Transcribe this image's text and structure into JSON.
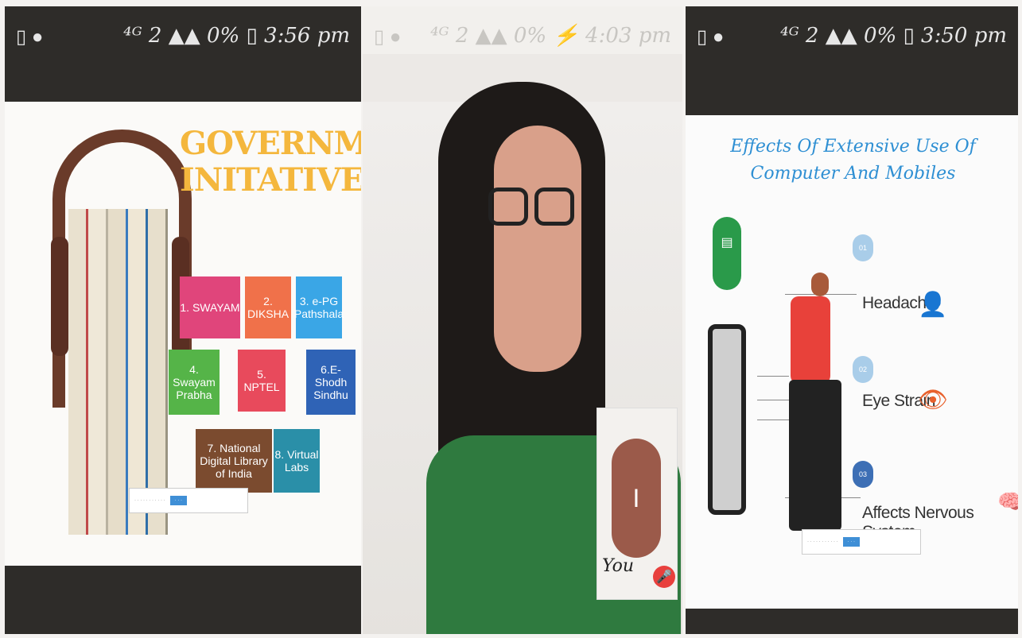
{
  "left_panel": {
    "status": {
      "left_icons": "▯ ●",
      "right_text": "⁴ᴳ 2 ▲▲ 0% ▯ 3:56 pm"
    },
    "title": "GOVERNMENT INITATIVES",
    "tiles": [
      {
        "label": "1. SWAYAM",
        "color": "#e0457b"
      },
      {
        "label": "2. DIKSHA",
        "color": "#f0714a"
      },
      {
        "label": "3. e-PG Pathshala",
        "color": "#3aa6e6"
      },
      {
        "label": "4. Swayam Prabha",
        "color": "#55b448"
      },
      {
        "label": "5. NPTEL",
        "color": "#e84a5c"
      },
      {
        "label": "6.E-Shodh Sindhu",
        "color": "#2f63b6"
      },
      {
        "label": "7. National Digital Library of India",
        "color": "#7b4b2f"
      },
      {
        "label": "8. Virtual Labs",
        "color": "#2a8fa8"
      }
    ]
  },
  "middle_panel": {
    "status": {
      "left_icons": "▯ ●",
      "right_text": "⁴ᴳ 2 ▲▲ 0% ⚡ 4:03 pm"
    },
    "self_view": {
      "avatar_letter": "I",
      "label": "You",
      "mic_icon": "🎤"
    }
  },
  "right_panel": {
    "status": {
      "left_icons": "▯ ●",
      "right_text": "⁴ᴳ 2 ▲▲ 0% ▯ 3:50 pm"
    },
    "title": "Effects Of Extensive Use Of Computer And Mobiles",
    "effects": [
      {
        "number": "01",
        "label": "Headache",
        "icon": "👤"
      },
      {
        "number": "02",
        "label": "Eye Strain",
        "icon": "👁"
      },
      {
        "number": "03",
        "label": "Affects Nervous System",
        "icon": "🧠"
      }
    ]
  }
}
